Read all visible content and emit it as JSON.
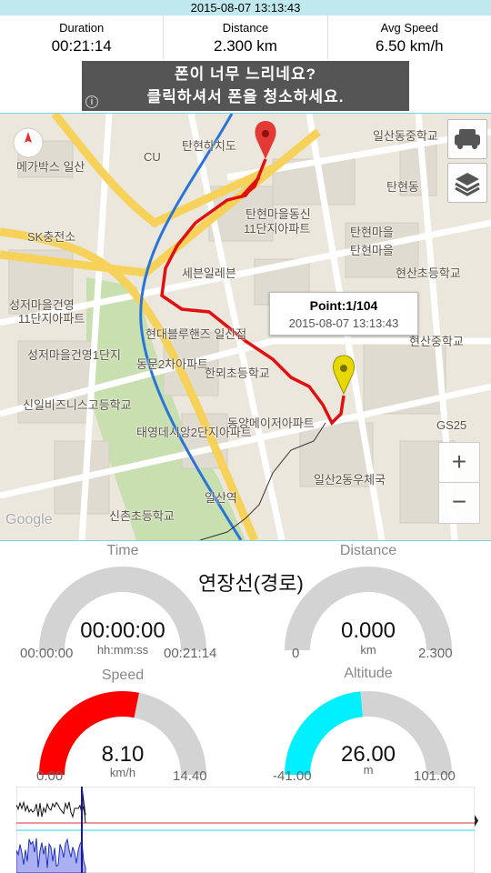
{
  "status_bar": {
    "datetime": "2015-08-07 13:13:43"
  },
  "stats": [
    {
      "label": "Duration",
      "value": "00:21:14"
    },
    {
      "label": "Distance",
      "value": "2.300 km"
    },
    {
      "label": "Avg Speed",
      "value": "6.50 km/h"
    }
  ],
  "ad": {
    "line1": "폰이 너무 느리네요?",
    "line2": "클릭하셔서 폰을 청소하세요.",
    "info_icon": "info-icon"
  },
  "map": {
    "labels": [
      "메가박스 일산",
      "SK충전소",
      "CU",
      "탄현하치도",
      "탄현마을동신",
      "11단지아파트",
      "세븐일레븐",
      "탄현마을",
      "현산초등학교",
      "탄현마을",
      "성저마을건영",
      "11단지아파트",
      "성저마을건영1단지",
      "현대블루핸즈 일산점",
      "동문2차아파트",
      "한뫼초등학교",
      "신일비즈니스고등학교",
      "태영데시앙2단지아파트",
      "동양메이저아파트",
      "일산2동우체국",
      "현산중학교",
      "GS25",
      "신촌초등학교",
      "일산역",
      "Google",
      "일산동중학교",
      "탄현동"
    ],
    "popup": {
      "title": "Point:1/104",
      "subtitle": "2015-08-07 13:13:43"
    },
    "buttons": {
      "zoom_in": "+",
      "zoom_out": "−"
    }
  },
  "annotation": "연장선(경로)",
  "gauges": [
    {
      "name": "time",
      "label": "Time",
      "value": "00:00:00",
      "unit": "hh:mm:ss",
      "min": "00:00:00",
      "max": "00:21:14",
      "fraction": 0,
      "color": "#ff0000"
    },
    {
      "name": "distance",
      "label": "Distance",
      "value": "0.000",
      "unit": "km",
      "min": "0",
      "max": "2.300",
      "fraction": 0,
      "color": "#ff0000"
    },
    {
      "name": "speed",
      "label": "Speed",
      "value": "8.10",
      "unit": "km/h",
      "min": "0.00",
      "max": "14.40",
      "fraction": 0.5625,
      "color": "#ff0000"
    },
    {
      "name": "altitude",
      "label": "Altitude",
      "value": "26.00",
      "unit": "m",
      "min": "-41.00",
      "max": "101.00",
      "fraction": 0.47,
      "color": "#00f0ff"
    }
  ],
  "nav": {
    "left": "〈",
    "right": "〉"
  },
  "colors": {
    "statusbar": "#bfe9ee",
    "route": "#e01010",
    "track_blue": "#1a6fd6",
    "graph_fill": "#aab0f0"
  }
}
